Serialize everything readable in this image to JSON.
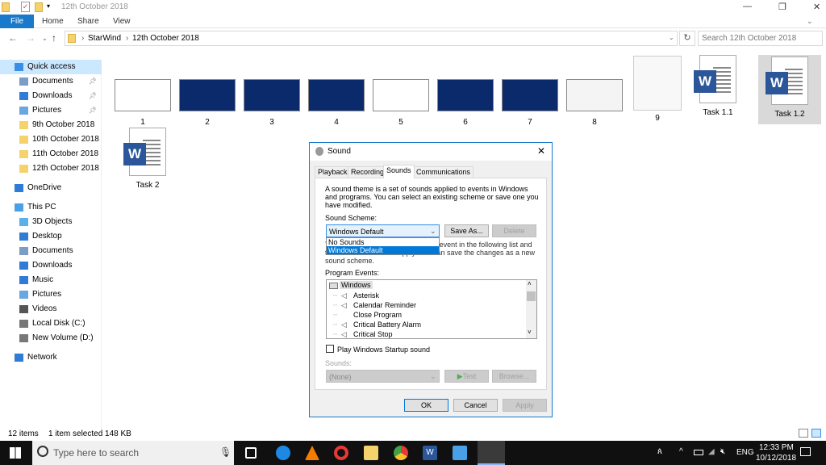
{
  "window": {
    "title": "12th October 2018",
    "minimize": "—",
    "maximize": "❐",
    "close": "✕"
  },
  "ribbon": {
    "tabs": [
      "File",
      "Home",
      "Share",
      "View"
    ]
  },
  "address": {
    "path": [
      "StarWind",
      "12th October 2018"
    ],
    "search_placeholder": "Search 12th October 2018"
  },
  "sidebar": {
    "items": [
      {
        "label": "Quick access",
        "icon": "star-icon",
        "color": "#3a8ee6",
        "sel": true
      },
      {
        "label": "Documents",
        "icon": "documents-icon",
        "color": "#7a9cc6",
        "pin": true
      },
      {
        "label": "Downloads",
        "icon": "download-icon",
        "color": "#2f7bd6",
        "pin": true
      },
      {
        "label": "Pictures",
        "icon": "pictures-icon",
        "color": "#6aa6e0",
        "pin": true
      },
      {
        "label": "9th October 2018",
        "icon": "folder-icon",
        "color": "#f5d26b"
      },
      {
        "label": "10th October 2018",
        "icon": "folder-icon",
        "color": "#f5d26b"
      },
      {
        "label": "11th October 2018",
        "icon": "folder-icon",
        "color": "#f5d26b"
      },
      {
        "label": "12th October 2018",
        "icon": "folder-icon",
        "color": "#f5d26b"
      },
      {
        "label": "OneDrive",
        "icon": "cloud-icon",
        "color": "#2f7bd6"
      },
      {
        "label": "This PC",
        "icon": "computer-icon",
        "color": "#4aa0e6"
      },
      {
        "label": "3D Objects",
        "icon": "cube-icon",
        "color": "#5ab0e8"
      },
      {
        "label": "Desktop",
        "icon": "desktop-icon",
        "color": "#2f7bd6"
      },
      {
        "label": "Documents",
        "icon": "documents-icon",
        "color": "#7a9cc6"
      },
      {
        "label": "Downloads",
        "icon": "download-icon",
        "color": "#2f7bd6"
      },
      {
        "label": "Music",
        "icon": "music-icon",
        "color": "#2f7bd6"
      },
      {
        "label": "Pictures",
        "icon": "pictures-icon",
        "color": "#6aa6e0"
      },
      {
        "label": "Videos",
        "icon": "videos-icon",
        "color": "#555"
      },
      {
        "label": "Local Disk (C:)",
        "icon": "drive-icon",
        "color": "#777"
      },
      {
        "label": "New Volume (D:)",
        "icon": "drive-icon",
        "color": "#777"
      },
      {
        "label": "Network",
        "icon": "network-icon",
        "color": "#2f7bd6"
      }
    ]
  },
  "files": [
    "1",
    "2",
    "3",
    "4",
    "5",
    "6",
    "7",
    "8",
    "9",
    "Task 1.1",
    "Task 1.2",
    "Task 2"
  ],
  "status": {
    "count": "12 items",
    "selected": "1 item selected  148 KB"
  },
  "dialog": {
    "title": "Sound",
    "tabs": [
      "Playback",
      "Recording",
      "Sounds",
      "Communications"
    ],
    "description": "A sound theme is a set of sounds applied to events in Windows and programs.  You can select an existing scheme or save one you have modified.",
    "scheme_label": "Sound Scheme:",
    "scheme_value": "Windows Default",
    "scheme_options": [
      "No Sounds",
      "Windows Default"
    ],
    "save_as": "Save As...",
    "delete": "Delete",
    "desc2": "To change sounds, click a program event in the following list and then select a sound to apply.  You can save the changes as a new sound scheme.",
    "events_label": "Program Events:",
    "events_root": "Windows",
    "events": [
      {
        "label": "Asterisk",
        "sound": true
      },
      {
        "label": "Calendar Reminder",
        "sound": true
      },
      {
        "label": "Close Program",
        "sound": false
      },
      {
        "label": "Critical Battery Alarm",
        "sound": true
      },
      {
        "label": "Critical Stop",
        "sound": true
      }
    ],
    "startup_label": "Play Windows Startup sound",
    "startup_checked": false,
    "sounds_label": "Sounds:",
    "sounds_value": "(None)",
    "test": "Test",
    "browse": "Browse...",
    "ok": "OK",
    "cancel": "Cancel",
    "apply": "Apply"
  },
  "taskbar": {
    "search_placeholder": "Type here to search",
    "lang": "ENG",
    "time": "12:33 PM",
    "date": "10/12/2018"
  }
}
